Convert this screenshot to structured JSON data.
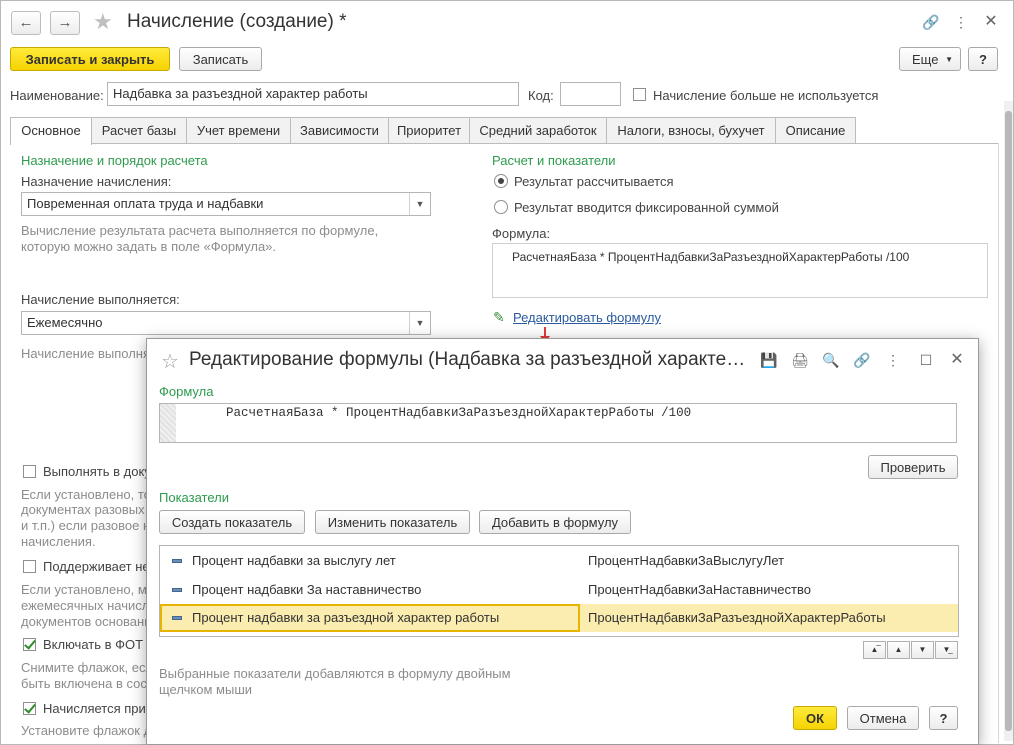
{
  "window": {
    "title": "Начисление (создание) *"
  },
  "toolbar": {
    "save_close": "Записать и закрыть",
    "save": "Записать",
    "more": "Еще",
    "help": "?"
  },
  "header": {
    "name_label": "Наименование:",
    "name_value": "Надбавка за разъездной характер работы",
    "code_label": "Код:",
    "code_value": "",
    "unused_label": "Начисление больше не используется"
  },
  "tabs": [
    "Основное",
    "Расчет базы",
    "Учет времени",
    "Зависимости",
    "Приоритет",
    "Средний заработок",
    "Налоги, взносы, бухучет",
    "Описание"
  ],
  "left": {
    "section_title": "Назначение и порядок расчета",
    "purpose_label": "Назначение начисления:",
    "purpose_value": "Повременная оплата труда и надбавки",
    "purpose_hint_1": "Вычисление результата расчета выполняется по формуле,",
    "purpose_hint_2": "которую можно задать в поле «Формула».",
    "when_label": "Начисление выполняется:",
    "when_value": "Ежемесячно",
    "when_hint": "Начисление выполня",
    "cb1_label": "Выполнять в доку",
    "cb1_hint_1": "Если установлено, то",
    "cb1_hint_2": "документах разовых",
    "cb1_hint_3": "и т.п.) если разовое н",
    "cb1_hint_4": "начисления.",
    "cb2_label": "Поддерживает не",
    "cb2_hint_1": "Если установлено, м",
    "cb2_hint_2": "ежемесячных начисл",
    "cb2_hint_3": "документов основани",
    "cb3_label": "Включать в ФОТ",
    "cb3_hint_1": "Снимите флажок, есл",
    "cb3_hint_2": "быть включена в сос",
    "cb4_label": "Начисляется при",
    "cb4_hint_1": "Установите флажок д"
  },
  "right": {
    "section_title": "Расчет и показатели",
    "radio1": "Результат рассчитывается",
    "radio2": "Результат вводится фиксированной суммой",
    "formula_label": "Формула:",
    "formula_value": "РасчетнаяБаза  * ПроцентНадбавкиЗаРазъезднойХарактерРаботы /100",
    "edit_link": "Редактировать формулу"
  },
  "dialog": {
    "title": "Редактирование формулы (Надбавка за разъездной характер...",
    "formula_title": "Формула",
    "formula_text": "РасчетнаяБаза  * ПроцентНадбавкиЗаРазъезднойХарактерРаботы /100",
    "check_btn": "Проверить",
    "indicators_title": "Показатели",
    "create_btn": "Создать показатель",
    "change_btn": "Изменить показатель",
    "add_btn": "Добавить в формулу",
    "rows": [
      {
        "name": "Процент надбавки за выслугу лет",
        "id": "ПроцентНадбавкиЗаВыслугуЛет"
      },
      {
        "name": "Процент надбавки За наставничество",
        "id": "ПроцентНадбавкиЗаНаставничество"
      },
      {
        "name": "Процент надбавки за разъездной характер работы",
        "id": "ПроцентНадбавкиЗаРазъезднойХарактерРаботы"
      }
    ],
    "note_1": "Выбранные показатели добавляются в формулу двойным",
    "note_2": "щелчком мыши",
    "ok": "ОК",
    "cancel": "Отмена",
    "help": "?"
  },
  "colors": {
    "accent_yellow": "#f6d300",
    "section_green": "#2e9b4e",
    "selection": "#fbedb0"
  }
}
